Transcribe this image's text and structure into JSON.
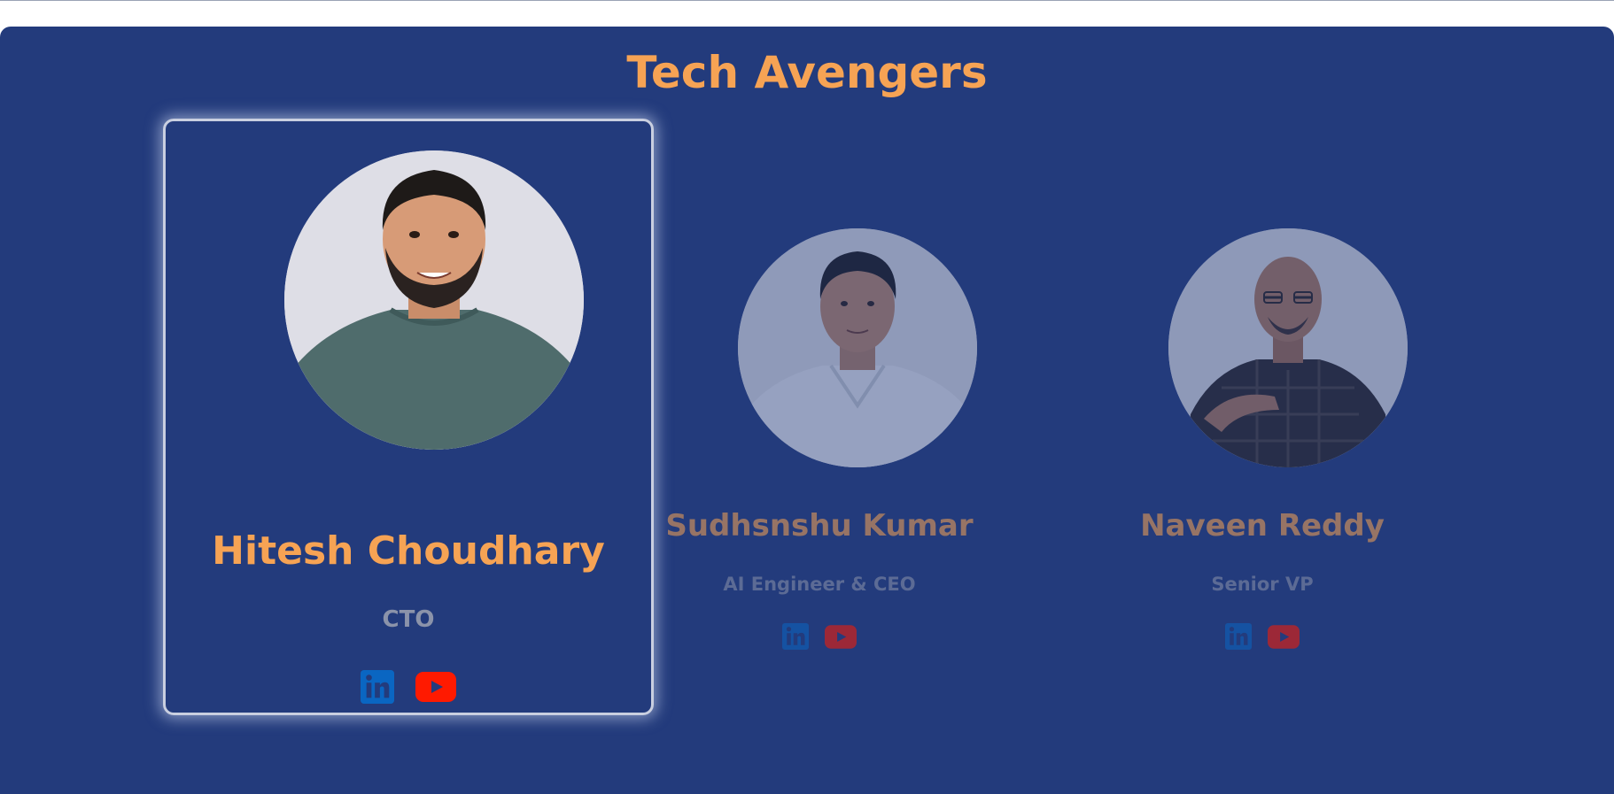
{
  "section": {
    "title": "Tech Avengers",
    "background_color": "#233b7c",
    "accent_color": "#f6a354"
  },
  "members": [
    {
      "name": "Hitesh Choudhary",
      "role": "CTO",
      "active": true,
      "socials": [
        {
          "icon": "linkedin-icon",
          "color": "#0a66c2"
        },
        {
          "icon": "youtube-icon",
          "color": "#ff1a00"
        }
      ]
    },
    {
      "name": "Sudhsnshu Kumar",
      "role": "AI Engineer & CEO",
      "active": false,
      "socials": [
        {
          "icon": "linkedin-icon",
          "color": "#0a66c2"
        },
        {
          "icon": "youtube-icon",
          "color": "#ff1a00"
        }
      ]
    },
    {
      "name": "Naveen Reddy",
      "role": "Senior VP",
      "active": false,
      "socials": [
        {
          "icon": "linkedin-icon",
          "color": "#0a66c2"
        },
        {
          "icon": "youtube-icon",
          "color": "#ff1a00"
        }
      ]
    }
  ]
}
